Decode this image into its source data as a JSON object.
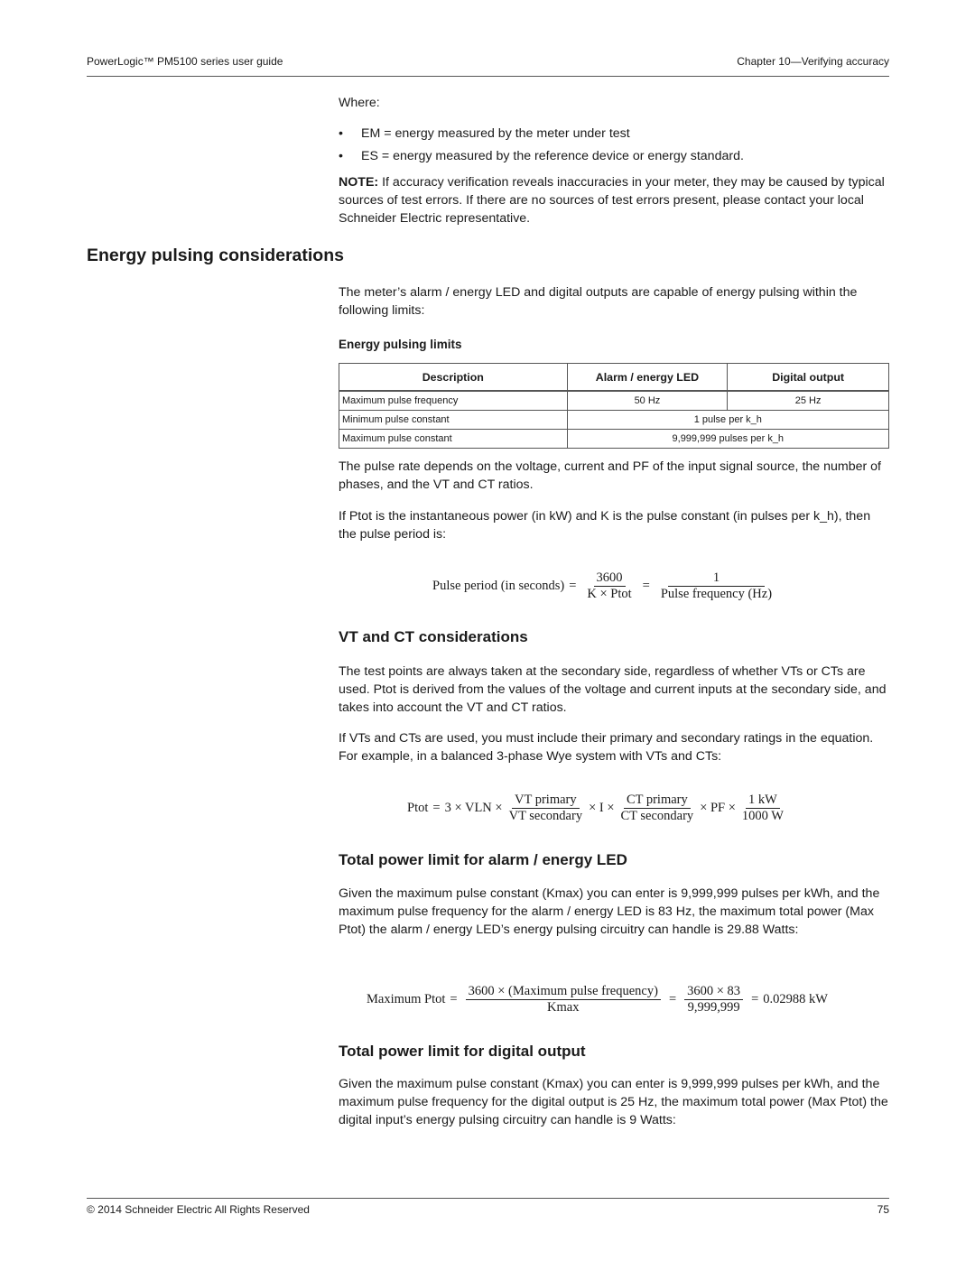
{
  "header": {
    "left": "PowerLogic™  PM5100 series user guide",
    "right": "Chapter 10—Verifying accuracy"
  },
  "intro": {
    "where": "Where:",
    "bullets": [
      "EM = energy measured by the meter under test",
      "ES = energy measured by the reference device or energy standard."
    ],
    "bullet_symbol": "•",
    "note_label": "NOTE:",
    "note_text": " If accuracy verification reveals inaccuracies in your meter, they may be caused by typical sources of test errors. If there are no sources of test errors present, please contact your local Schneider Electric representative."
  },
  "energy_pulsing": {
    "title": "Energy pulsing considerations",
    "para1": "The meter’s alarm / energy LED and digital outputs are capable of energy pulsing within the following limits:",
    "table_caption": "Energy pulsing limits",
    "table": {
      "headers": [
        "Description",
        "Alarm / energy LED",
        "Digital output"
      ],
      "rows": [
        {
          "description": "Maximum pulse frequency",
          "led": "50 Hz",
          "digital": "25 Hz"
        },
        {
          "description": "Minimum pulse constant",
          "merged": "1 pulse per k_h"
        },
        {
          "description": "Maximum pulse constant",
          "merged": "9,999,999 pulses per k_h"
        }
      ]
    },
    "para2": "The pulse rate depends on the voltage, current and PF of the input signal source, the number of phases, and the VT and CT ratios.",
    "para3": "If Ptot is the instantaneous power (in kW) and K is the pulse constant (in pulses per k_h), then the pulse period is:",
    "equation": {
      "lhs": "Pulse period (in seconds)",
      "eq": "=",
      "frac1_num": "3600",
      "frac1_den": "K × Ptot",
      "frac2_num": "1",
      "frac2_den": "Pulse frequency (Hz)"
    }
  },
  "vt_ct": {
    "title": "VT and CT considerations",
    "para1": "The test points are always taken at the secondary side, regardless of whether VTs or CTs are used. Ptot is derived from the values of the voltage and current inputs at the secondary side, and takes into account the VT and CT ratios.",
    "para2": "If VTs and CTs are used, you must include their primary and secondary ratings in the equation. For example, in a balanced 3-phase Wye system with VTs and CTs:",
    "equation": {
      "lhs": "Ptot",
      "eq": "=",
      "term1": "3 × VLN ×",
      "vt_num": "VT primary",
      "vt_den": "VT secondary",
      "term2": "× I ×",
      "ct_num": "CT primary",
      "ct_den": "CT secondary",
      "term3": "× PF ×",
      "unit_num": "1 kW",
      "unit_den": "1000 W"
    }
  },
  "led_limit": {
    "title": "Total power limit for alarm / energy LED",
    "para": "Given the maximum pulse constant (Kmax) you can enter is 9,999,999 pulses per kWh, and the maximum pulse frequency for the alarm / energy LED is 83 Hz, the maximum total power (Max Ptot) the alarm / energy LED’s energy pulsing circuitry can handle is 29.88 Watts:",
    "equation": {
      "lhs": "Maximum Ptot",
      "eq": "=",
      "frac1_num": "3600 × (Maximum pulse frequency)",
      "frac1_den": "Kmax",
      "frac2_num": "3600 × 83",
      "frac2_den": "9,999,999",
      "result": "0.02988 kW"
    }
  },
  "digital_limit": {
    "title": "Total power limit for digital output",
    "para": "Given the maximum pulse constant (Kmax) you can enter is 9,999,999 pulses per kWh, and the maximum pulse frequency for the digital output is 25 Hz, the maximum total power (Max Ptot) the digital input’s energy pulsing circuitry can handle is 9 Watts:"
  },
  "footer": {
    "left": "© 2014 Schneider Electric All Rights Reserved",
    "page": "75"
  }
}
